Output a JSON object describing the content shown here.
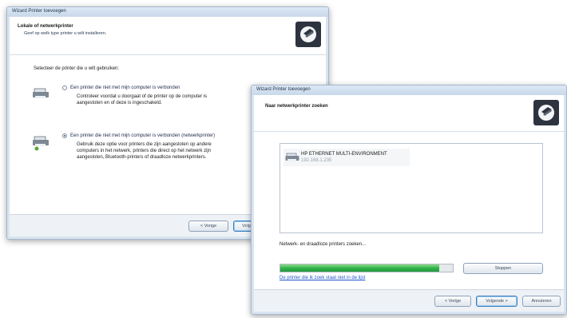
{
  "back_window": {
    "title": "Wizard Printer toevoegen",
    "header_title": "Lokale of netwerkprinter",
    "header_subtitle": "Geef op welk type printer u wilt installeren.",
    "prompt": "Selecteer de printer die u wilt gebruiken:",
    "option1_label": "Een printer die niet met mijn computer is verbonden",
    "option1_desc_line1": "Controleer voordat u doorgaat of de printer op de computer is",
    "option1_desc_line2": "aangesloten en of deze is ingeschakeld.",
    "option2_label": "Een printer die niet met mijn computer is verbonden (netwerkprinter)",
    "option2_desc_line1": "Gebruik deze optie voor printers die zijn aangesloten op andere",
    "option2_desc_line2": "computers in het netwerk, printers die direct op het netwerk zijn",
    "option2_desc_line3": "aangesloten, Bluetooth-printers of draadloze netwerkprinters.",
    "back_button": "< Vorige",
    "next_button": "Volgende >"
  },
  "front_window": {
    "title": "Wizard Printer toevoegen",
    "header_title": "Naar netwerkprinter zoeken",
    "printer_name": "HP ETHERNET MULTI-ENVIRONMENT",
    "printer_address": "192.168.1.235",
    "search_status": "Netwerk- en draadloze printers zoeken...",
    "progress_fraction": 0.92,
    "stop_button": "Stoppen",
    "not_listed_link": "De printer die ik zoek staat niet in de lijst",
    "back_button": "< Vorige",
    "next_button": "Volgende >",
    "cancel_button": "Annuleren"
  },
  "colors": {
    "progress_green": "#2fb34a",
    "link_blue": "#1f56c8",
    "header_icon_bg": "#2e3340"
  }
}
